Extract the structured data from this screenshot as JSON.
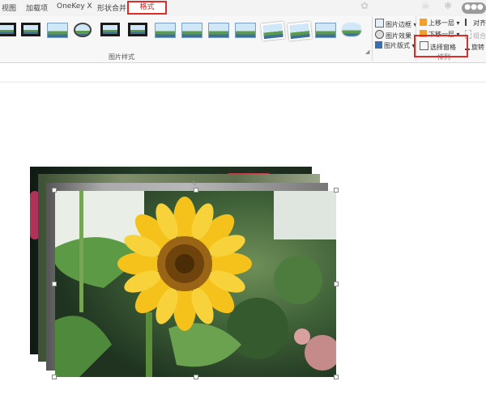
{
  "ribbon": {
    "tabs": [
      "视图",
      "加载项",
      "OneKey X",
      "形状合并"
    ],
    "active_tab": "格式",
    "style_group_label": "图片样式",
    "arrange_group_label": "排列",
    "commands": {
      "border": "图片边框",
      "effects": "图片效果",
      "layout": "图片版式",
      "bring_forward": "上移一层",
      "send_backward": "下移一层",
      "selection_pane": "选择窗格",
      "align": "对齐",
      "group": "组合",
      "rotate": "旋转"
    }
  },
  "colors": {
    "highlight": "#e02b2b",
    "ribbon_bg": "#f7f7f7",
    "tab_bar_bg": "#f3f3f3"
  }
}
